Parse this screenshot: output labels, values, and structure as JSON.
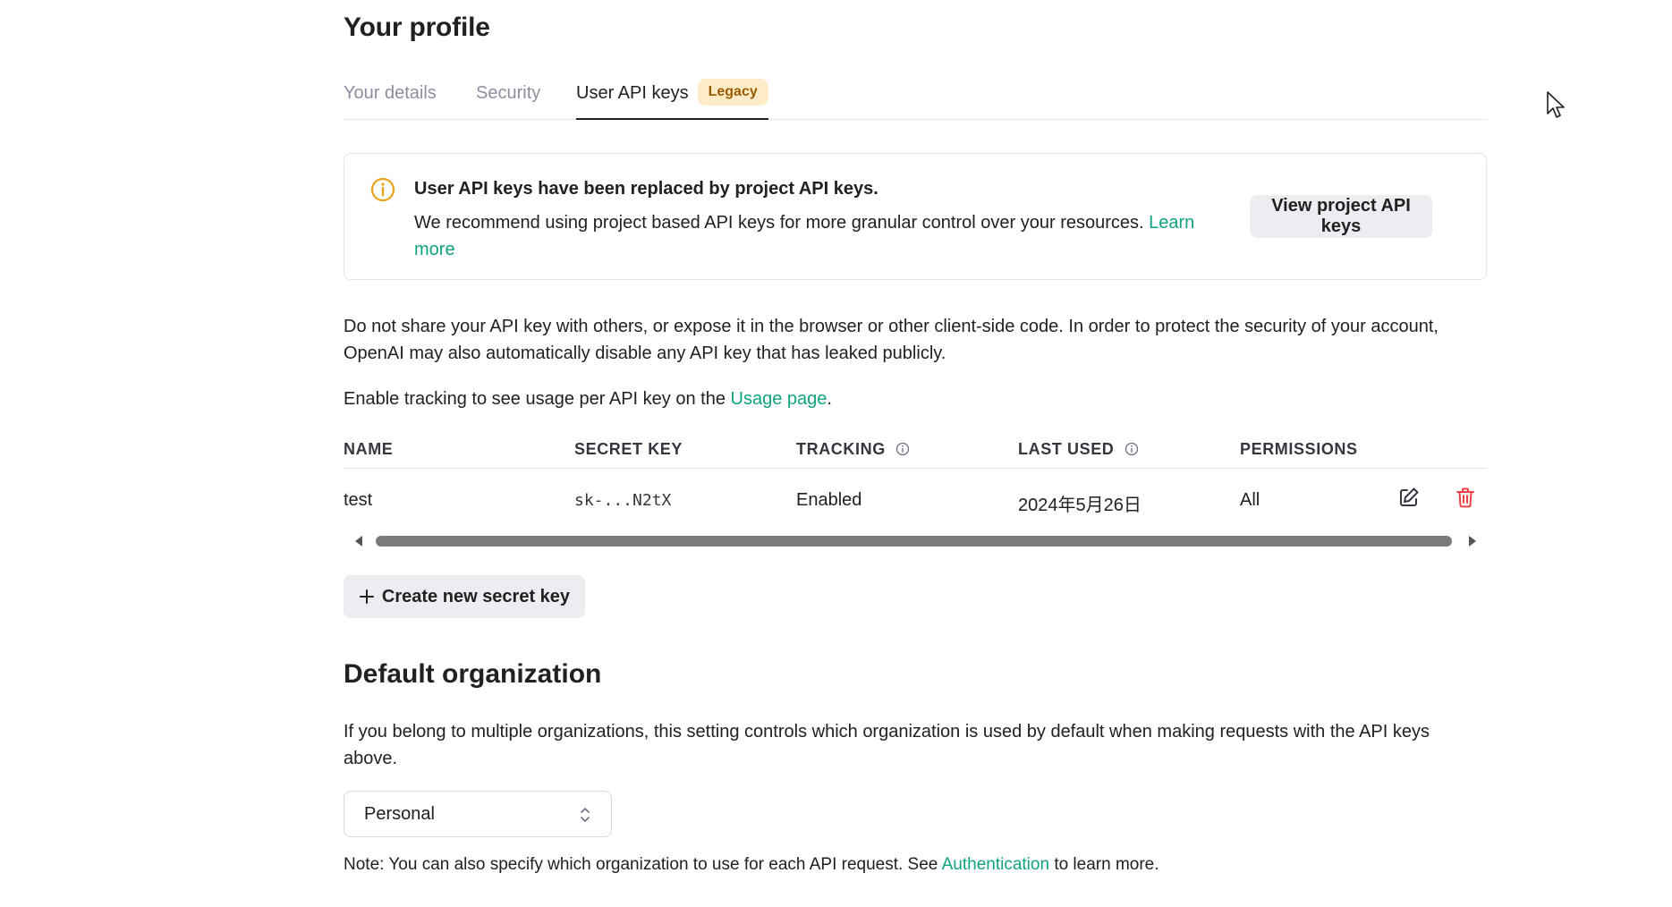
{
  "page": {
    "title": "Your profile"
  },
  "tabs": [
    {
      "label": "Your details"
    },
    {
      "label": "Security"
    },
    {
      "label": "User API keys",
      "badge": "Legacy"
    }
  ],
  "notice": {
    "title": "User API keys have been replaced by project API keys.",
    "body": "We recommend using project based API keys for more granular control over your resources.",
    "link_learn": "Learn",
    "link_more": "more",
    "button": "View project API keys"
  },
  "warning": {
    "line1": "Do not share your API key with others, or expose it in the browser or other client-side code. In order to protect the security of your account,",
    "line2": "OpenAI may also automatically disable any API key that has leaked publicly."
  },
  "tracking_note": {
    "prefix": "Enable tracking to see usage per API key on the",
    "link": "Usage page",
    "suffix": "."
  },
  "table": {
    "headers": {
      "name": "NAME",
      "secret_key": "SECRET KEY",
      "tracking": "TRACKING",
      "last_used": "LAST USED",
      "permissions": "PERMISSIONS"
    },
    "rows": [
      {
        "name": "test",
        "secret_key": "sk-...N2tX",
        "tracking": "Enabled",
        "last_used": "2024年5月26日",
        "permissions": "All"
      }
    ]
  },
  "create_button": {
    "icon": "plus-icon",
    "label": "Create new secret key"
  },
  "default_org": {
    "title": "Default organization",
    "line1": "If you belong to multiple organizations, this setting controls which organization is used by default when making requests with the API keys",
    "line2": "above.",
    "selected": "Personal",
    "note_prefix": "Note: You can also specify which organization to use for each API request. See",
    "note_link": "Authentication",
    "note_suffix": "to learn more."
  },
  "colors": {
    "accent_link": "#10a37f",
    "legacy_badge_bg": "#fdecc7",
    "legacy_badge_text": "#9a5b00",
    "info_icon": "#e8a317",
    "delete_icon": "#ef4146"
  }
}
